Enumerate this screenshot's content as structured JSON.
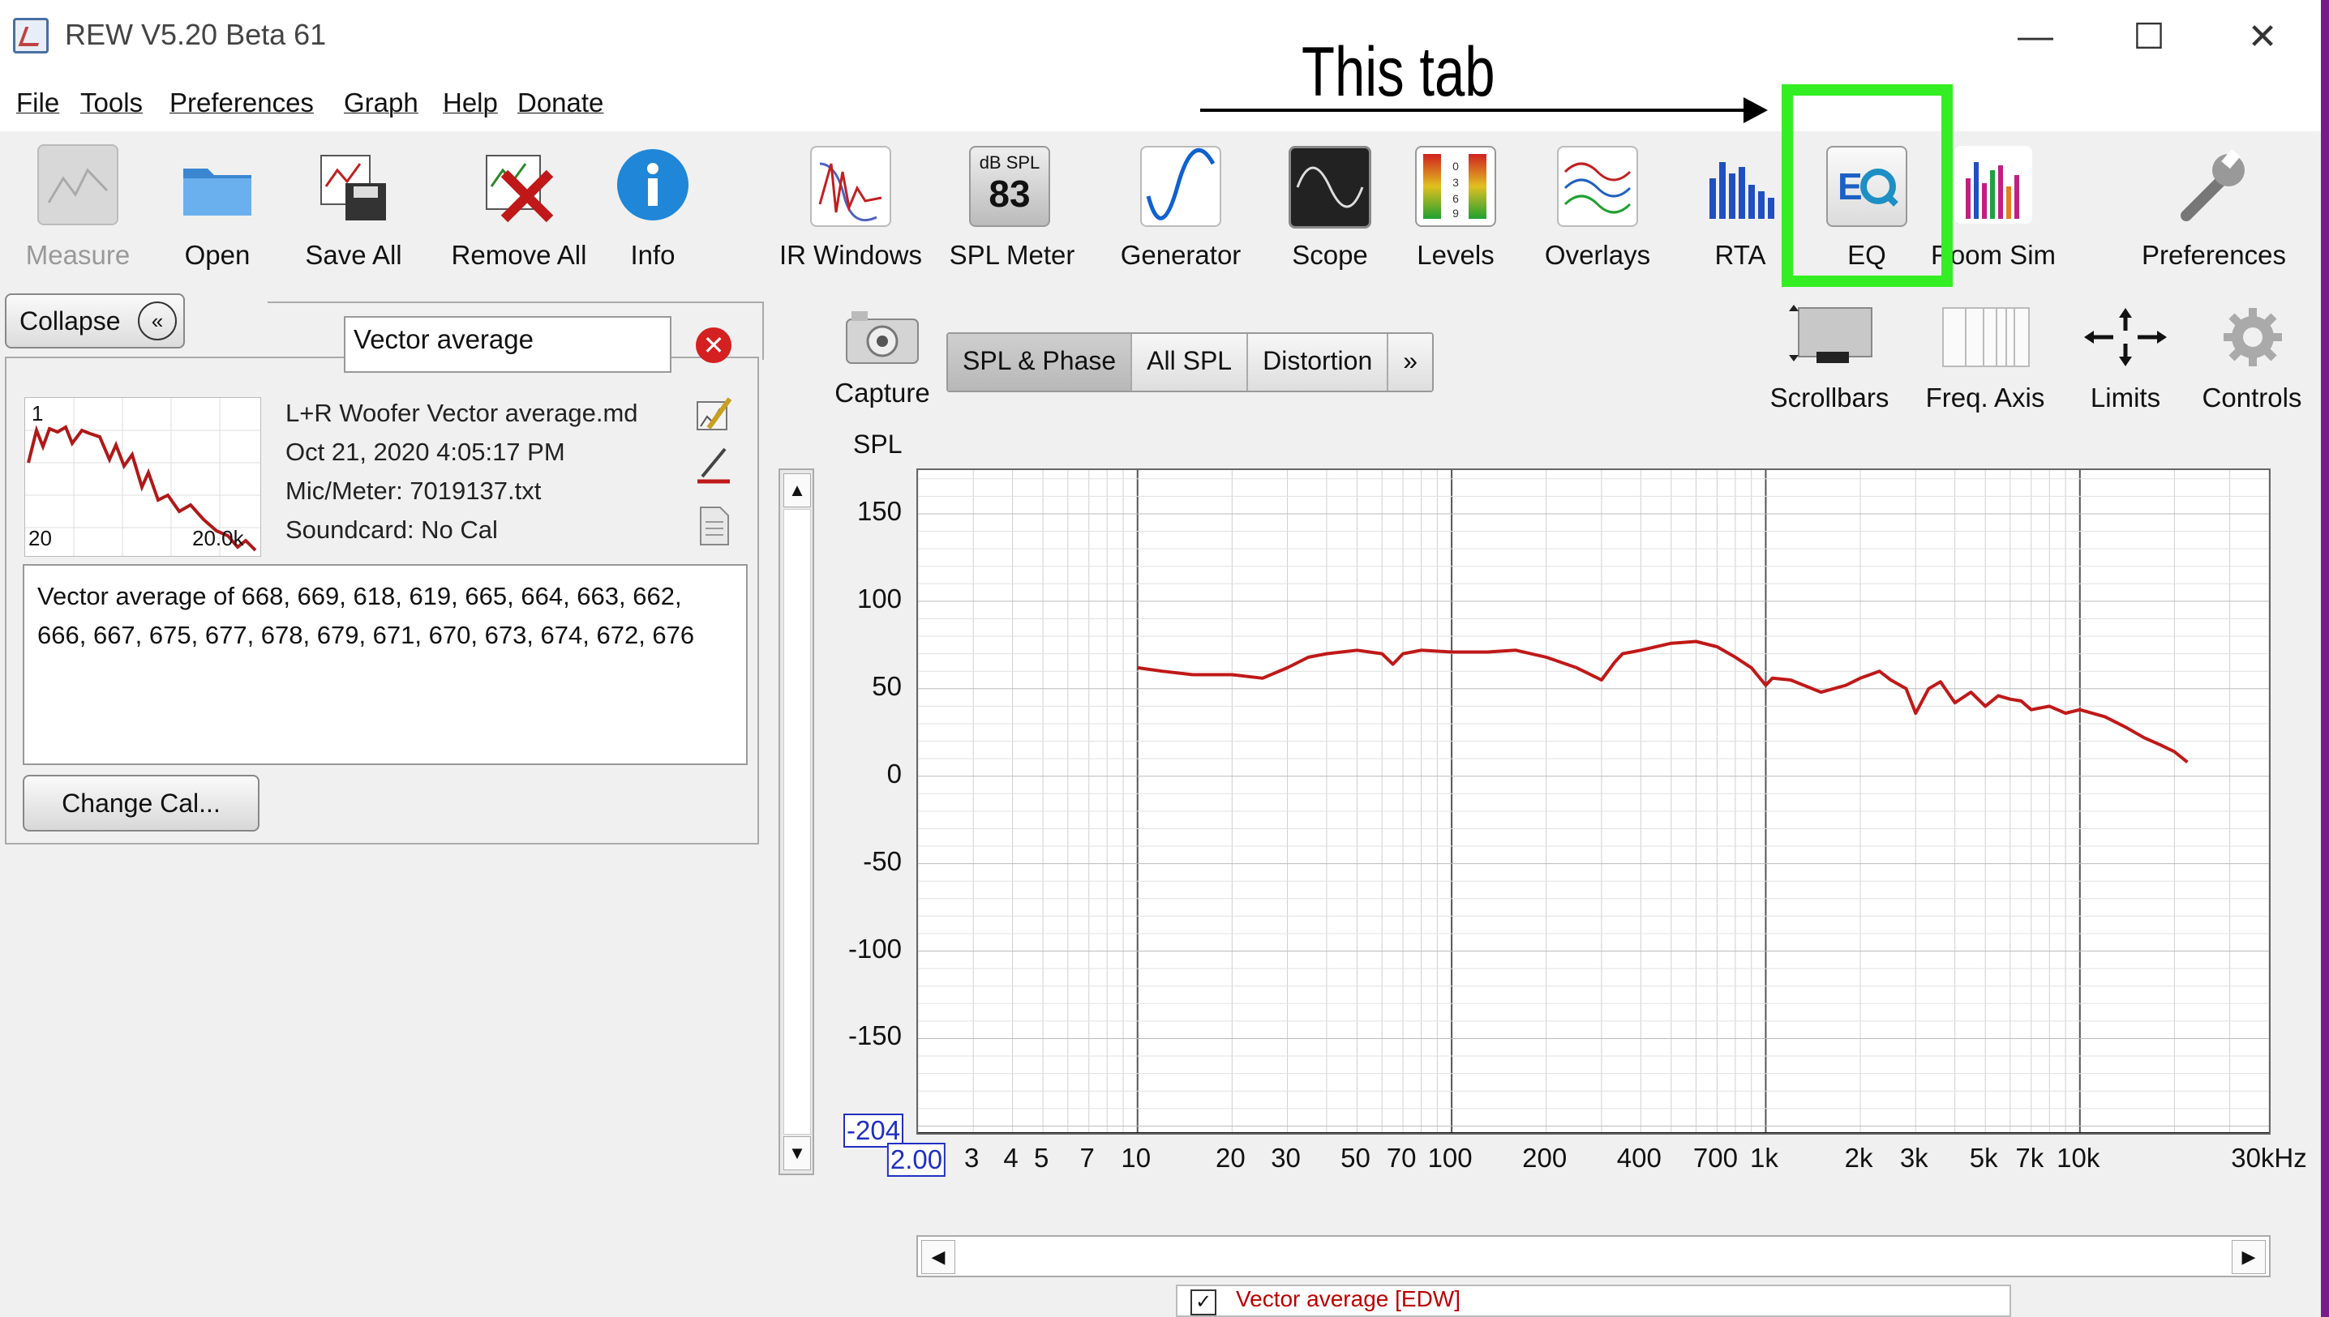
{
  "window": {
    "title": "REW V5.20 Beta 61",
    "minimize": "—",
    "maximize": "☐",
    "close": "✕"
  },
  "menu": [
    "File",
    "Tools",
    "Preferences",
    "Graph",
    "Help",
    "Donate"
  ],
  "annotation": {
    "text": "This tab"
  },
  "toolbar": [
    {
      "label": "Measure",
      "icon": "measure-icon",
      "disabled": true
    },
    {
      "label": "Open",
      "icon": "folder-icon"
    },
    {
      "label": "Save All",
      "icon": "save-all-icon"
    },
    {
      "label": "Remove All",
      "icon": "remove-all-icon"
    },
    {
      "label": "Info",
      "icon": "info-icon"
    },
    {
      "label": "IR Windows",
      "icon": "ir-windows-icon"
    },
    {
      "label": "SPL Meter",
      "icon": "spl-meter-icon",
      "badge_top": "dB SPL",
      "badge_value": "83"
    },
    {
      "label": "Generator",
      "icon": "generator-icon"
    },
    {
      "label": "Scope",
      "icon": "scope-icon"
    },
    {
      "label": "Levels",
      "icon": "levels-icon"
    },
    {
      "label": "Overlays",
      "icon": "overlays-icon"
    },
    {
      "label": "RTA",
      "icon": "rta-icon"
    },
    {
      "label": "EQ",
      "icon": "eq-icon"
    },
    {
      "label": "Room Sim",
      "icon": "room-sim-icon"
    },
    {
      "label": "Preferences",
      "icon": "wrench-icon"
    }
  ],
  "panel": {
    "collapse_label": "Collapse",
    "search_value": "Vector average",
    "measurement": {
      "name": "L+R Woofer Vector average.md",
      "date": "Oct 21, 2020 4:05:17 PM",
      "mic": "Mic/Meter: 7019137.txt",
      "soundcard": "Soundcard: No Cal",
      "index": "1",
      "thumb_min": "20",
      "thumb_max": "20.0k"
    },
    "notes": "Vector average of 668, 669, 618, 619, 665, 664, 663, 662, 666, 667, 675, 677, 678, 679, 671, 670, 673, 674, 672, 676",
    "change_cal_label": "Change Cal..."
  },
  "graph_controls": {
    "capture_label": "Capture",
    "tabs": [
      "SPL & Phase",
      "All SPL",
      "Distortion",
      "»"
    ],
    "selected_tab": "SPL & Phase",
    "tools": [
      "Scrollbars",
      "Freq. Axis",
      "Limits",
      "Controls"
    ]
  },
  "chart_data": {
    "type": "line",
    "ylabel": "SPL",
    "y_ticks": [
      "150",
      "100",
      "50",
      "0",
      "-50",
      "-100",
      "-150"
    ],
    "ylim": [
      -204,
      175
    ],
    "y_min_box": "-204",
    "x_scale": "log",
    "x_tick_labels": [
      "2.00",
      "3",
      "4",
      "5",
      "7",
      "10",
      "20",
      "30",
      "50",
      "70",
      "100",
      "200",
      "400",
      "700",
      "1k",
      "2k",
      "3k",
      "5k",
      "7k",
      "10k",
      "30kHz"
    ],
    "x_tick_values": [
      2,
      3,
      4,
      5,
      7,
      10,
      20,
      30,
      50,
      70,
      100,
      200,
      400,
      700,
      1000,
      2000,
      3000,
      5000,
      7000,
      10000,
      30000
    ],
    "xlim": [
      2,
      40000
    ],
    "series": [
      {
        "name": "Vector average [EDW]",
        "color": "#c01818",
        "x": [
          10,
          12,
          15,
          20,
          25,
          30,
          35,
          40,
          50,
          60,
          65,
          70,
          80,
          100,
          130,
          160,
          200,
          250,
          300,
          330,
          350,
          400,
          500,
          600,
          700,
          800,
          900,
          1000,
          1050,
          1200,
          1500,
          1800,
          2000,
          2300,
          2500,
          2800,
          3000,
          3300,
          3600,
          4000,
          4500,
          5000,
          5500,
          6000,
          6500,
          7000,
          8000,
          9000,
          10000,
          12000,
          14000,
          16000,
          18000,
          20000,
          22000
        ],
        "y": [
          62,
          60,
          58,
          58,
          56,
          62,
          68,
          70,
          72,
          70,
          64,
          70,
          72,
          71,
          71,
          72,
          68,
          62,
          55,
          65,
          70,
          72,
          76,
          77,
          74,
          68,
          62,
          52,
          56,
          55,
          48,
          52,
          56,
          60,
          55,
          50,
          36,
          50,
          54,
          42,
          48,
          40,
          46,
          44,
          43,
          38,
          40,
          36,
          38,
          34,
          28,
          22,
          18,
          14,
          8
        ]
      }
    ],
    "grid": true,
    "legend": "bottom"
  }
}
